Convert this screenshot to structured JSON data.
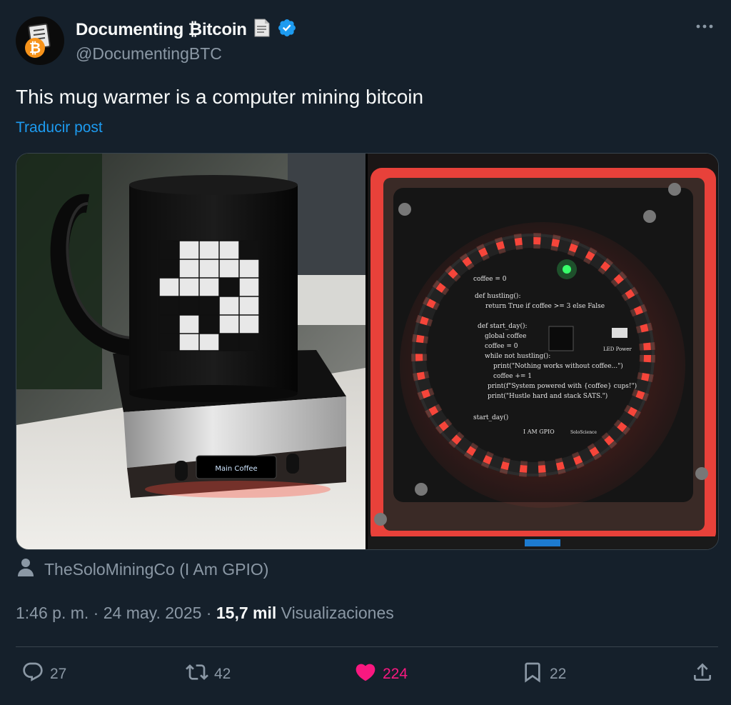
{
  "author": {
    "name": "Documenting ₿itcoin",
    "handle": "@DocumentingBTC",
    "verified": true,
    "badge_icon": "document-icon",
    "verified_icon": "verified-badge-icon"
  },
  "post": {
    "text": "This mug warmer is a computer mining bitcoin",
    "translate_label": "Traducir post"
  },
  "media": {
    "count": 2,
    "screen_label": "Main Coffee",
    "pcb_code": [
      "coffee = 0",
      "def hustling():",
      "return True if coffee >= 3 else False",
      "def start_day():",
      "global coffee",
      "coffee = 0",
      "while not hustling():",
      "print(\"Nothing works without coffee...\")",
      "coffee += 1",
      "print(f\"System powered with {coffee} cups!\")",
      "print(\"Hustle hard and stack SATS.\")",
      "start_day()"
    ],
    "pcb_labels": {
      "led_power": "LED Power",
      "brand": "I AM GPIO",
      "brand2": "SoloScience"
    }
  },
  "credit": {
    "text": "TheSoloMiningCo (I Am GPIO)"
  },
  "meta": {
    "time": "1:46 p. m.",
    "separator": "·",
    "date": "24 may. 2025",
    "views_count": "15,7 mil",
    "views_label": "Visualizaciones"
  },
  "actions": {
    "replies": "27",
    "reposts": "42",
    "likes": "224",
    "bookmarks": "22"
  },
  "colors": {
    "background": "#15202b",
    "accent": "#1d9bf0",
    "like": "#f91880",
    "muted": "#8b98a5",
    "led": "#ff3b30"
  }
}
